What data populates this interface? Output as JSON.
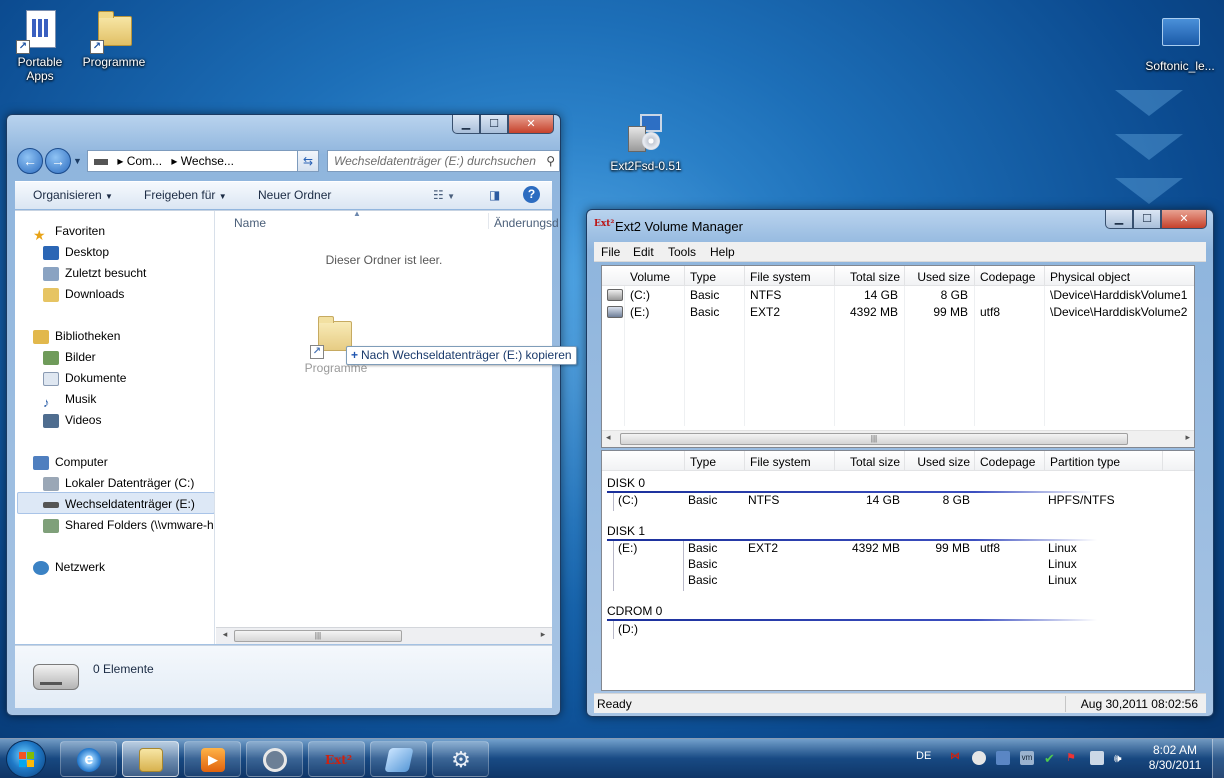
{
  "desktop": {
    "icons": [
      {
        "label": "Portable\nApps",
        "icon": "portable-apps-icon"
      },
      {
        "label": "Programme",
        "icon": "folder-shortcut-icon"
      },
      {
        "label": "Ext2Fsd-0.51",
        "icon": "installer-icon"
      },
      {
        "label": "Softonic_le...",
        "icon": "softonic-icon"
      }
    ]
  },
  "explorer": {
    "address_parts": [
      "Com...",
      "Wechse..."
    ],
    "search_placeholder": "Wechseldatenträger (E:) durchsuchen",
    "toolbar": {
      "organize": "Organisieren",
      "share": "Freigeben für",
      "new_folder": "Neuer Ordner"
    },
    "nav": {
      "favorites": "Favoriten",
      "desktop": "Desktop",
      "recent": "Zuletzt besucht",
      "downloads": "Downloads",
      "libraries": "Bibliotheken",
      "pictures": "Bilder",
      "documents": "Dokumente",
      "music": "Musik",
      "videos": "Videos",
      "computer": "Computer",
      "local_disk": "Lokaler Datenträger (C:)",
      "removable": "Wechseldatenträger (E:)",
      "shared": "Shared Folders (\\\\vmware-h",
      "network": "Netzwerk"
    },
    "columns": {
      "name": "Name",
      "modified": "Änderungsd"
    },
    "empty_message": "Dieser Ordner ist leer.",
    "drag_item": "Programme",
    "drag_tooltip": "Nach Wechseldatenträger (E:) kopieren",
    "item_count": "0 Elemente"
  },
  "ext2": {
    "title": "Ext2 Volume Manager",
    "menu": [
      "File",
      "Edit",
      "Tools",
      "Help"
    ],
    "volume_columns": [
      "Volume",
      "Type",
      "File system",
      "Total size",
      "Used size",
      "Codepage",
      "Physical object"
    ],
    "volumes": [
      {
        "volume": "(C:)",
        "type": "Basic",
        "fs": "NTFS",
        "total": "14 GB",
        "used": "8 GB",
        "codepage": "",
        "physical": "\\Device\\HarddiskVolume1"
      },
      {
        "volume": "(E:)",
        "type": "Basic",
        "fs": "EXT2",
        "total": "4392 MB",
        "used": "99 MB",
        "codepage": "utf8",
        "physical": "\\Device\\HarddiskVolume2"
      }
    ],
    "disk_columns": [
      "Type",
      "File system",
      "Total size",
      "Used size",
      "Codepage",
      "Partition type"
    ],
    "disks": {
      "disk0": {
        "label": "DISK 0",
        "vol": "(C:)",
        "type": "Basic",
        "fs": "NTFS",
        "total": "14 GB",
        "used": "8 GB",
        "ptype": "HPFS/NTFS"
      },
      "disk1": {
        "label": "DISK 1",
        "vol": "(E:)",
        "type": "Basic",
        "fs": "EXT2",
        "total": "4392 MB",
        "used": "99 MB",
        "codepage": "utf8",
        "ptype": "Linux",
        "type2": "Basic",
        "ptype2": "Linux",
        "type3": "Basic",
        "ptype3": "Linux"
      },
      "cdrom0": {
        "label": "CDROM 0",
        "vol": "(D:)"
      }
    },
    "status_left": "Ready",
    "status_right": "Aug 30,2011 08:02:56"
  },
  "taskbar": {
    "language": "DE",
    "time": "8:02 AM",
    "date": "8/30/2011"
  },
  "colors": {
    "accent": "#1f55b0",
    "disk_rule": "#1a2f9a",
    "close_button": "#c6412b"
  }
}
